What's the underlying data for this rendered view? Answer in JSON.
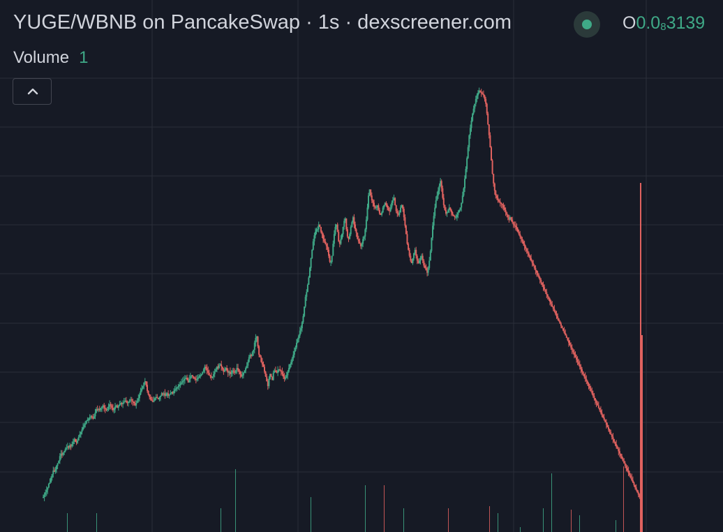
{
  "header": {
    "title": "YUGE/WBNB on PancakeSwap · 1s · dexscreener.com",
    "ohlc_label": "O",
    "ohlc_value_prefix": "0.0",
    "ohlc_value_sub": "8",
    "ohlc_value_suffix": "3139"
  },
  "volume": {
    "label": "Volume",
    "value": "1"
  },
  "icons": {
    "status": "status-dot-icon",
    "collapse": "chevron-up-icon"
  },
  "colors": {
    "background": "#161a25",
    "grid": "#2a2e39",
    "up": "#3fa987",
    "down": "#e0625f",
    "text": "#d1d4dc"
  },
  "chart_data": {
    "type": "candlestick",
    "title": "YUGE/WBNB on PancakeSwap · 1s · dexscreener.com",
    "interval": "1s",
    "grid": true,
    "ylim": [
      0,
      100
    ],
    "close": [
      0,
      2,
      4,
      6,
      8,
      11,
      12,
      16,
      19,
      22,
      21,
      23,
      26,
      28,
      30,
      34,
      36,
      35,
      37,
      38,
      40,
      41,
      42,
      41,
      43,
      42,
      44,
      46,
      48,
      46,
      45,
      47,
      50,
      52,
      54,
      56,
      58,
      60,
      61,
      63,
      64,
      65,
      66,
      67,
      66,
      65,
      67,
      70,
      73,
      72,
      73,
      72,
      74,
      75,
      76,
      74,
      73,
      72,
      73,
      75,
      77,
      76,
      74,
      72,
      73,
      75,
      76,
      74,
      76,
      77,
      78,
      77,
      78,
      79,
      80,
      79,
      78,
      79,
      80,
      81,
      80,
      79,
      78,
      76,
      78,
      80,
      82,
      85,
      88,
      90,
      92,
      95,
      96,
      93,
      88,
      85,
      83,
      81,
      80,
      79,
      80,
      82,
      83,
      82,
      81,
      83,
      84,
      86,
      85,
      86,
      84,
      85,
      86,
      84,
      85,
      86,
      87,
      86,
      88,
      89,
      90,
      91,
      92,
      93,
      94,
      95,
      96,
      97,
      98,
      99,
      97,
      95,
      98,
      100,
      101,
      100,
      99,
      98,
      97,
      98,
      99,
      100,
      101,
      102,
      104,
      106,
      108,
      107,
      105,
      103,
      101,
      100,
      99,
      100,
      102,
      104,
      106,
      108,
      107,
      109,
      110,
      108,
      106,
      104,
      105,
      107,
      105,
      103,
      104,
      102,
      103,
      105,
      104,
      103,
      105,
      107,
      106,
      104,
      102,
      100,
      101,
      103,
      105,
      107,
      109,
      112,
      116,
      118,
      117,
      120,
      122,
      128,
      132,
      133,
      125,
      118,
      116,
      112,
      110,
      108,
      104,
      100,
      96,
      92,
      98,
      102,
      100,
      97,
      103,
      105,
      104,
      103,
      105,
      106,
      105,
      104,
      102,
      100,
      98,
      99,
      101,
      104,
      107,
      110,
      112,
      115,
      118,
      121,
      124,
      128,
      131,
      134,
      138,
      140,
      145,
      150,
      158,
      166,
      170,
      176,
      182,
      190,
      198,
      205,
      212,
      217,
      220,
      222,
      222,
      226,
      224,
      220,
      218,
      214,
      212,
      210,
      208,
      205,
      200,
      195,
      195,
      200,
      210,
      218,
      224,
      226,
      220,
      212,
      210,
      214,
      218,
      224,
      229,
      231,
      222,
      216,
      214,
      218,
      224,
      228,
      232,
      226,
      222,
      219,
      214,
      212,
      210,
      208,
      210,
      214,
      216,
      222,
      230,
      240,
      250,
      255,
      250,
      246,
      244,
      241,
      240,
      240,
      242,
      238,
      235,
      234,
      236,
      240,
      242,
      244,
      242,
      240,
      238,
      237,
      240,
      244,
      246,
      248,
      242,
      237,
      235,
      234,
      236,
      240,
      242,
      239,
      232,
      225,
      218,
      210,
      205,
      200,
      196,
      194,
      198,
      202,
      205,
      200,
      196,
      194,
      196,
      198,
      200,
      196,
      192,
      190,
      188,
      186,
      190,
      196,
      204,
      215,
      225,
      233,
      240,
      246,
      250,
      254,
      258,
      262,
      256,
      248,
      242,
      238,
      235,
      236,
      238,
      240,
      238,
      236,
      234,
      233,
      232,
      232,
      234,
      236,
      238,
      240,
      244,
      250,
      256,
      264,
      272,
      281,
      290,
      300,
      306,
      312,
      318,
      322,
      326,
      330,
      333,
      335,
      337,
      336,
      335,
      334,
      333,
      330,
      326,
      318,
      309,
      300,
      290,
      279,
      268,
      260,
      254,
      250,
      248,
      246,
      245,
      244,
      243,
      242,
      240,
      238,
      236,
      234,
      232,
      230,
      232,
      230,
      228,
      226,
      225,
      224,
      222,
      220,
      218,
      216,
      214,
      212,
      210,
      208,
      206,
      204,
      202,
      200,
      198,
      196,
      194,
      192,
      190,
      188,
      186,
      184,
      182,
      180,
      178,
      176,
      174,
      172,
      170,
      168,
      166,
      164,
      162,
      160,
      158,
      156,
      154,
      152,
      150,
      148,
      146,
      144,
      142,
      140,
      138,
      136,
      134,
      132,
      130,
      128,
      126,
      124,
      122,
      120,
      118,
      116,
      114,
      112,
      110,
      108,
      106,
      104,
      102,
      100,
      98,
      96,
      94,
      92,
      90,
      88,
      86,
      84,
      82,
      80,
      78,
      76,
      74,
      72,
      70,
      68,
      66,
      64,
      62,
      60,
      58,
      56,
      54,
      52,
      50,
      48,
      46,
      44,
      42,
      40,
      38,
      36,
      34,
      32,
      30,
      28,
      26,
      24,
      22,
      20,
      18,
      16,
      14,
      12,
      10,
      8,
      6,
      4,
      2,
      0
    ]
  }
}
